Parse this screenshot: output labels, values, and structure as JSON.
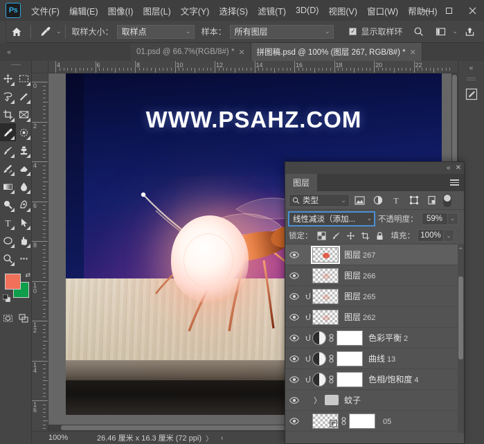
{
  "app": {
    "logo": "Ps"
  },
  "menubar": {
    "items": [
      {
        "label": "文件(F)"
      },
      {
        "label": "编辑(E)"
      },
      {
        "label": "图像(I)"
      },
      {
        "label": "图层(L)"
      },
      {
        "label": "文字(Y)"
      },
      {
        "label": "选择(S)"
      },
      {
        "label": "滤镜(T)"
      },
      {
        "label": "3D(D)"
      },
      {
        "label": "视图(V)"
      },
      {
        "label": "窗口(W)"
      },
      {
        "label": "帮助(H)"
      }
    ],
    "window_controls": {
      "minimize": "—",
      "maximize": "▢",
      "close": "✕"
    }
  },
  "optionsbar": {
    "home_icon": "home-icon",
    "tool_icon": "eyedropper-icon",
    "sample_size_label": "取样大小：",
    "sample_size_value": "取样点",
    "sample_label": "样本：",
    "sample_value": "所有图层",
    "show_ring_label": "显示取样环",
    "show_ring_checked": "✓",
    "search_icon": "search-icon",
    "workspace_icon": "workspace-icon",
    "share_icon": "share-icon"
  },
  "tabbar": {
    "collapse_icon": "«",
    "tabs": [
      {
        "label": "01.psd @ 66.7%(RGB/8#) *",
        "close": "✕",
        "active": false
      },
      {
        "label": "拼图稿.psd @ 100% (图层 267, RGB/8#) *",
        "close": "✕",
        "active": true
      }
    ]
  },
  "toolbar": {
    "tools": [
      {
        "name": "move-tool",
        "glyph": "✥"
      },
      {
        "name": "marquee-tool",
        "glyph": "▭"
      },
      {
        "name": "lasso-tool",
        "glyph": "◺"
      },
      {
        "name": "magic-wand-tool",
        "glyph": "✧"
      },
      {
        "name": "crop-tool",
        "glyph": "⌗"
      },
      {
        "name": "frame-tool",
        "glyph": "⊠"
      },
      {
        "name": "eyedropper-tool",
        "glyph": "✒"
      },
      {
        "name": "healing-brush-tool",
        "glyph": "◌"
      },
      {
        "name": "brush-tool",
        "glyph": "🖌"
      },
      {
        "name": "clone-stamp-tool",
        "glyph": "⎙"
      },
      {
        "name": "history-brush-tool",
        "glyph": "✎"
      },
      {
        "name": "eraser-tool",
        "glyph": "▰"
      },
      {
        "name": "gradient-tool",
        "glyph": "▤"
      },
      {
        "name": "blur-tool",
        "glyph": "💧"
      },
      {
        "name": "dodge-tool",
        "glyph": "🔍"
      },
      {
        "name": "pen-tool",
        "glyph": "✑"
      },
      {
        "name": "type-tool",
        "glyph": "T"
      },
      {
        "name": "path-selection-tool",
        "glyph": "➤"
      },
      {
        "name": "shape-tool",
        "glyph": "⬭"
      },
      {
        "name": "hand-tool",
        "glyph": "✋"
      },
      {
        "name": "zoom-tool",
        "glyph": "🔎"
      },
      {
        "name": "more-tools",
        "glyph": "⋯"
      }
    ],
    "foreground_color": "#f0705a",
    "background_color": "#0f9e4c",
    "swap_icon": "swap-colors-icon",
    "default_icon": "default-colors-icon",
    "quickmask_icon": "quick-mask-icon",
    "screenmode_icon": "screen-mode-icon"
  },
  "rulers": {
    "unit": "厘米",
    "horizontal_ticks": [
      "4",
      "6",
      "8",
      "10",
      "12",
      "14",
      "16",
      "18",
      "20",
      "22"
    ],
    "vertical_ticks": [
      "0",
      "2",
      "4",
      "6",
      "8",
      "10",
      "12",
      "14",
      "16"
    ]
  },
  "canvas": {
    "artwork_title": "WWW.PSAHZ.COM",
    "description": "mosquito-on-lightbulb-composite"
  },
  "statusbar": {
    "zoom": "100%",
    "doc_size": "26.46 厘米 x 16.3 厘米 (72 ppi)",
    "arrow_right": "〉",
    "arrow_left": "‹"
  },
  "right_dock": {
    "collapse_icon": "«",
    "icons": [
      {
        "name": "properties-icon",
        "glyph": "✎"
      }
    ]
  },
  "layers_panel": {
    "titlebar": {
      "collapse": "«",
      "close": "✕"
    },
    "tab_label": "图层",
    "menu_icon": "panel-menu-icon",
    "filter": {
      "search_icon": "search-icon",
      "type_label": "类型",
      "chevron": "⌄",
      "icons": [
        {
          "name": "filter-pixel-icon",
          "glyph": "▨"
        },
        {
          "name": "filter-adjustment-icon",
          "glyph": "◐"
        },
        {
          "name": "filter-type-icon",
          "glyph": "T"
        },
        {
          "name": "filter-shape-icon",
          "glyph": "⬚"
        },
        {
          "name": "filter-smartobject-icon",
          "glyph": "❏"
        }
      ],
      "toggle_name": "filter-enable-toggle"
    },
    "blend_mode": "线性减淡（添加...",
    "opacity_label": "不透明度：",
    "opacity_value": "59%",
    "lock_label": "锁定：",
    "lock_icons": [
      {
        "name": "lock-transparent-icon",
        "glyph": "▩"
      },
      {
        "name": "lock-image-icon",
        "glyph": "🖌"
      },
      {
        "name": "lock-position-icon",
        "glyph": "✥"
      },
      {
        "name": "lock-artboard-icon",
        "glyph": "⌗"
      },
      {
        "name": "lock-all-icon",
        "glyph": "🔒"
      }
    ],
    "fill_label": "填充：",
    "fill_value": "100%",
    "layers": [
      {
        "name": "图层",
        "num": "267",
        "type": "pixel",
        "visible": true,
        "selected": true,
        "clipped": false,
        "has_mask": false
      },
      {
        "name": "图层",
        "num": "266",
        "type": "pixel",
        "visible": true,
        "selected": false,
        "clipped": false,
        "has_mask": false
      },
      {
        "name": "图层",
        "num": "265",
        "type": "pixel",
        "visible": true,
        "selected": false,
        "clipped": true,
        "has_mask": false
      },
      {
        "name": "图层",
        "num": "262",
        "type": "pixel",
        "visible": true,
        "selected": false,
        "clipped": true,
        "has_mask": false
      },
      {
        "name": "色彩平衡",
        "num": "2",
        "type": "adjustment",
        "visible": true,
        "selected": false,
        "clipped": true,
        "has_mask": true
      },
      {
        "name": "曲线",
        "num": "13",
        "type": "adjustment",
        "visible": true,
        "selected": false,
        "clipped": true,
        "has_mask": true
      },
      {
        "name": "色相/饱和度",
        "num": "4",
        "type": "adjustment",
        "visible": true,
        "selected": false,
        "clipped": true,
        "has_mask": true
      },
      {
        "name": "蚊子",
        "num": "",
        "type": "group",
        "visible": true,
        "selected": false,
        "clipped": false,
        "has_mask": false
      },
      {
        "name": "",
        "num": "05",
        "type": "smart",
        "visible": true,
        "selected": false,
        "clipped": false,
        "has_mask": true
      }
    ],
    "eye_icon": "eye-icon",
    "clip_icon": "clipping-mask-icon",
    "link_icon": "link-icon",
    "folder_icon": "folder-icon",
    "group_chevron": "〉"
  }
}
